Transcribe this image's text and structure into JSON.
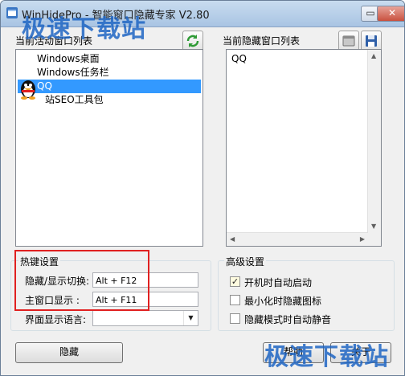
{
  "window": {
    "title": "WinHidePro - 智能窗口隐藏专家 V2.80",
    "minimize_label": "▭",
    "close_label": "✕"
  },
  "watermark": {
    "text": "极速下载站"
  },
  "left_panel": {
    "label": "当前活动窗口列表",
    "items": [
      {
        "label": "Windows桌面"
      },
      {
        "label": "Windows任务栏"
      },
      {
        "label": "QQ"
      },
      {
        "label": "站SEO工具包"
      }
    ]
  },
  "right_panel": {
    "label": "当前隐藏窗口列表",
    "items": [
      {
        "label": "QQ"
      }
    ]
  },
  "hotkeys": {
    "title": "热键设置",
    "hide_show_label": "隐藏/显示切换:",
    "hide_show_value": "Alt + F12",
    "main_window_label": "主窗口显示 :",
    "main_window_value": "Alt + F11",
    "language_label": "界面显示语言:"
  },
  "advanced": {
    "title": "高级设置",
    "options": [
      {
        "label": "开机时自动启动",
        "checked": true
      },
      {
        "label": "最小化时隐藏图标",
        "checked": false
      },
      {
        "label": "隐藏模式时自动静音",
        "checked": false
      }
    ]
  },
  "buttons": {
    "hide_label": "隐藏",
    "help_label": "帮助",
    "about_label": "关于"
  },
  "colors": {
    "selection": "#3399ff",
    "highlight_box": "#e02020",
    "watermark": "#1f66c4"
  }
}
